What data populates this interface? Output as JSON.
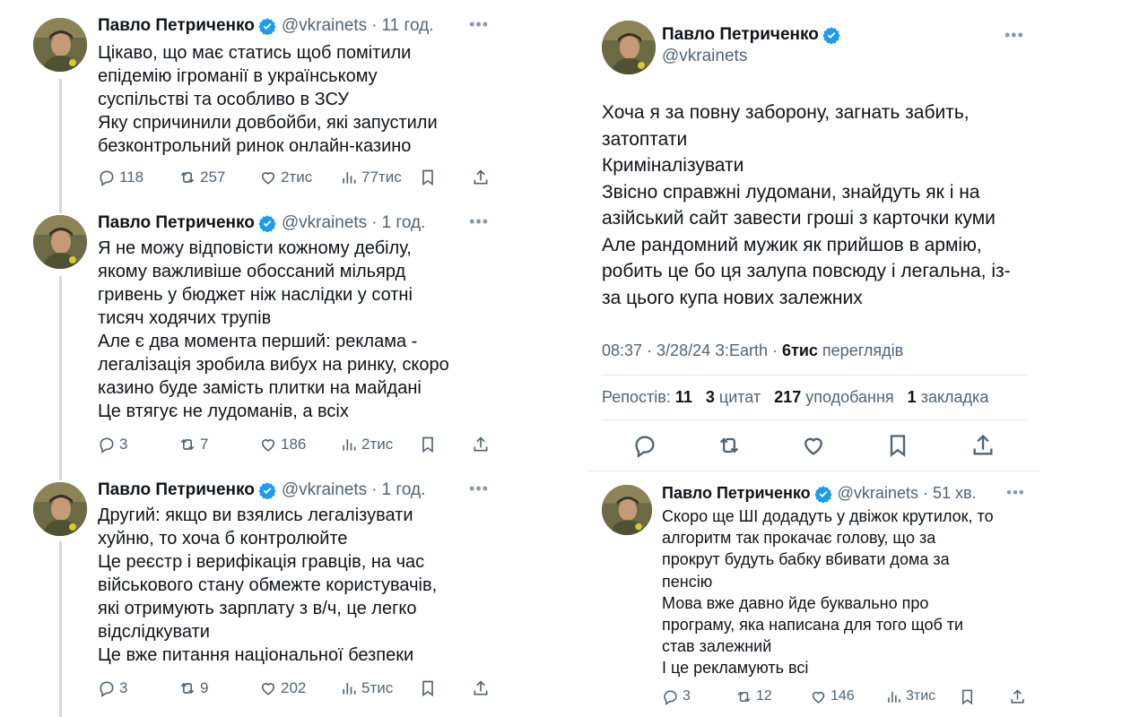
{
  "author": {
    "name": "Павло Петриченко",
    "handle": "@vkrainets"
  },
  "thread": [
    {
      "time": "11 год.",
      "lines": [
        "Цікаво, що має статись щоб помітили",
        "епідемію ігроманії в українському",
        "суспільстві та особливо в ЗСУ",
        "Яку спричинили довбойби, які запустили",
        "безконтрольний ринок онлайн-казино"
      ],
      "replies": "118",
      "reposts": "257",
      "likes": "2тис",
      "views": "77тис"
    },
    {
      "time": "1 год.",
      "lines": [
        "Я не можу відповісти кожному дебілу,",
        "якому важливіше обоссаний мільярд",
        "гривень у бюджет ніж наслідки у сотні",
        "тисяч ходячих трупів",
        "Але є два момента перший: реклама -",
        "легалізація зробила вибух на ринку, скоро",
        "казино буде замість плитки на майдані",
        "Це втягує не лудоманів, а всіх"
      ],
      "replies": "3",
      "reposts": "7",
      "likes": "186",
      "views": "2тис"
    },
    {
      "time": "1 год.",
      "lines": [
        "Другий: якщо ви взялись легалізувати",
        "хуйню, то хоча б контролюйте",
        "Це реєстр і верифікація гравців, на час",
        "військового стану обмежте користувачів,",
        "які отримують зарплату з в/ч, це легко",
        "відслідкувати",
        "Це вже питання національної безпеки"
      ],
      "replies": "3",
      "reposts": "9",
      "likes": "202",
      "views": "5тис"
    }
  ],
  "main_post": {
    "lines": [
      "Хоча я за повну заборону, загнать забить,",
      "затоптати",
      "Криміналізувати",
      "Звісно справжні лудомани, знайдуть як і на",
      "азійський сайт завести гроші з карточки куми",
      "Але рандомний мужик як прийшов в армію,",
      "робить це бо ця залупа повсюду і легальна, із-",
      "за цього купа нових залежних"
    ],
    "meta_prefix": "08:37 · 3/28/24 З:Earth · ",
    "views_count": "6тис",
    "views_label": "переглядів",
    "reposts_label": "Репостів:",
    "reposts_count": "11",
    "quotes_count": "3",
    "quotes_label": "цитат",
    "likes_count": "217",
    "likes_label": "уподобання",
    "bookmarks_count": "1",
    "bookmarks_label": "закладка"
  },
  "reply": {
    "time": "51 хв.",
    "lines": [
      "Скоро ще ШІ додадуть у двіжок крутилок, то",
      "алгоритм так прокачає голову, що за",
      "прокрут будуть бабку вбивати дома за",
      "пенсію",
      "Мова вже давно йде буквально про",
      "програму, яка написана для того щоб ти",
      "став залежний",
      "І це рекламують всі"
    ],
    "replies": "3",
    "reposts": "12",
    "likes": "146",
    "views": "3тис"
  },
  "colors": {
    "text": "#0f1419",
    "muted": "#536471",
    "verified": "#1d9bf0",
    "divider": "#e6ecf0",
    "thread_line": "#cfd9de"
  },
  "icons": [
    "reply-icon",
    "repost-icon",
    "like-icon",
    "views-icon",
    "bookmark-icon",
    "share-icon",
    "verified-icon",
    "more-icon"
  ]
}
